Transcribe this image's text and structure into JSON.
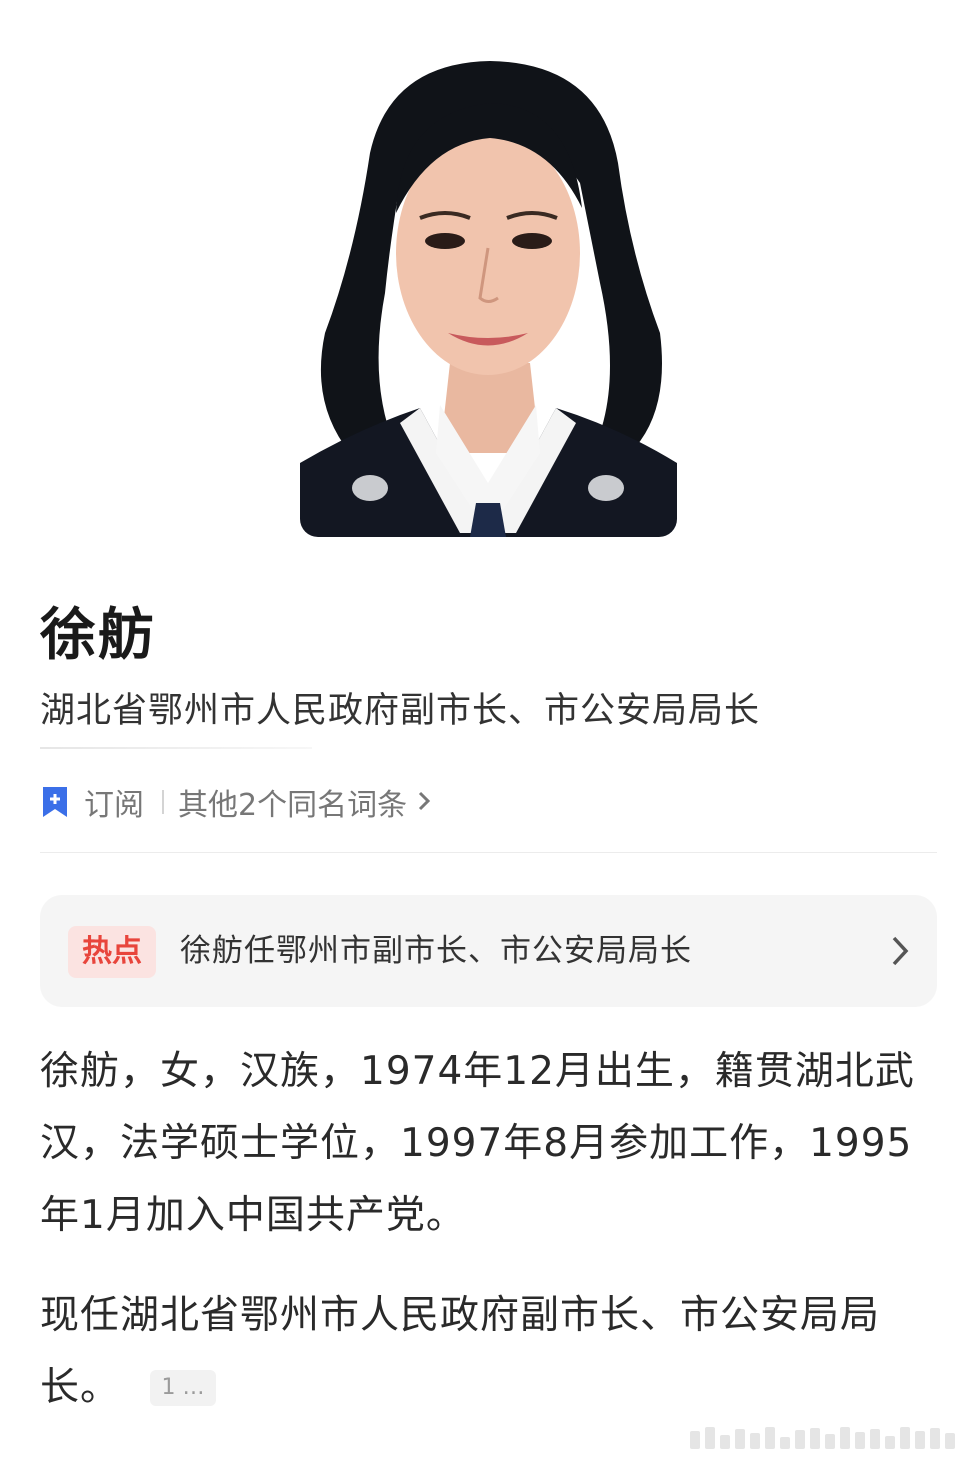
{
  "profile": {
    "name": "徐舫",
    "subtitle": "湖北省鄂州市人民政府副市长、市公安局局长"
  },
  "actions": {
    "subscribe_label": "订阅",
    "same_name_label": "其他2个同名词条"
  },
  "hot": {
    "badge": "热点",
    "text": "徐舫任鄂州市副市长、市公安局局长"
  },
  "summary": {
    "paragraph1": "徐舫，女，汉族，1974年12月出生，籍贯湖北武汉，法学硕士学位，1997年8月参加工作，1995年1月加入中国共产党。",
    "paragraph2": "现任湖北省鄂州市人民政府副市长、市公安局局长。",
    "citation": "1 …"
  },
  "colors": {
    "accent_blue": "#3b6fe8",
    "hot_red": "#e8453c",
    "hot_bg": "#fbe3e1",
    "card_bg": "#f5f5f5"
  },
  "icons": {
    "bookmark": "bookmark-plus-icon",
    "chevron": "chevron-right-icon"
  }
}
